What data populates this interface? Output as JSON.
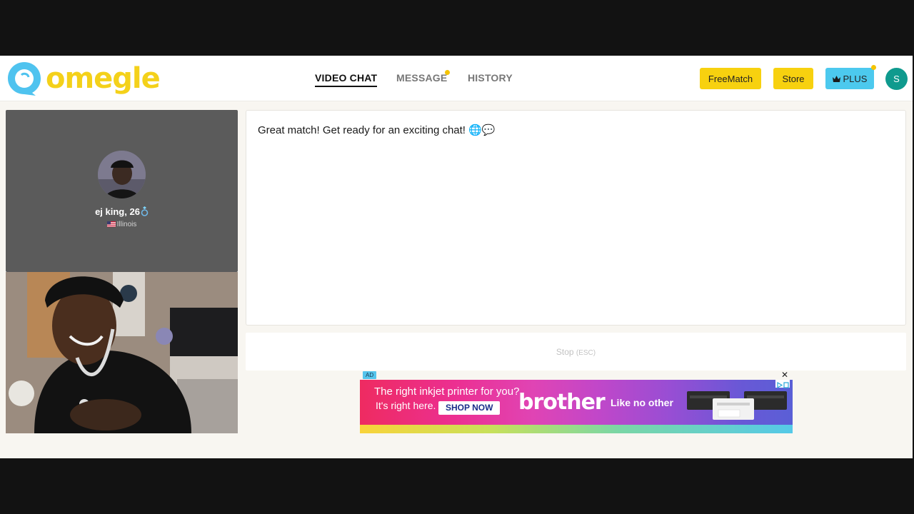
{
  "header": {
    "logo_text": "omegle",
    "nav": [
      {
        "label": "VIDEO CHAT",
        "active": true
      },
      {
        "label": "MESSAGE",
        "active": false,
        "dot": true
      },
      {
        "label": "HISTORY",
        "active": false
      }
    ],
    "buttons": {
      "freematch": "FreeMatch",
      "store": "Store",
      "plus": "PLUS"
    },
    "avatar_initial": "S"
  },
  "remote_user": {
    "name": "ej king, 26",
    "name_icon": "ring-icon",
    "location": "Illinois",
    "flag_icon": "us-flag-icon"
  },
  "chat": {
    "message": "Great match! Get ready for an exciting chat! 🌐💬"
  },
  "stop": {
    "label": "Stop",
    "shortcut": "(ESC)"
  },
  "ad": {
    "tag": "AD",
    "close": "✕",
    "line1": "The right inkjet printer for you?",
    "line2": "It's right here.",
    "cta": "SHOP NOW",
    "brand": "brother",
    "tagline": "Like no other"
  },
  "colors": {
    "brand_blue": "#4cc9ee",
    "brand_yellow": "#f7d10f",
    "avatar_teal": "#0f9a8e"
  }
}
